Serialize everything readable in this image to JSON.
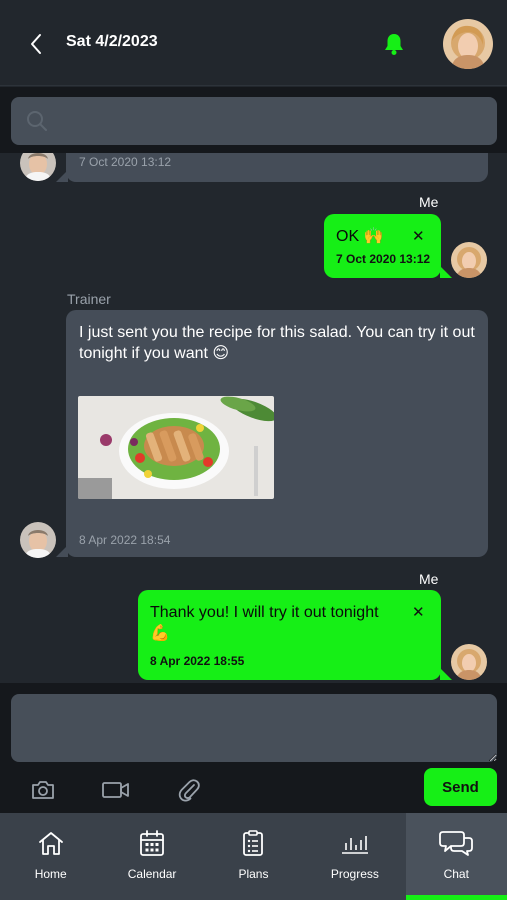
{
  "header": {
    "title": "Sat 4/2/2023"
  },
  "search": {
    "placeholder": ""
  },
  "messages": [
    {
      "direction": "in",
      "timestamp": "7 Oct 2020 13:12"
    },
    {
      "direction": "out",
      "sender": "Me",
      "text": "OK 🙌",
      "timestamp": "7 Oct 2020 13:12"
    },
    {
      "direction": "in",
      "sender": "Trainer",
      "text": "I just sent you the recipe for this salad. You can try it out tonight if you want 😊",
      "timestamp": "8 Apr 2022 18:54"
    },
    {
      "direction": "out",
      "sender": "Me",
      "text": "Thank you! I will try it out tonight 💪",
      "timestamp": "8 Apr 2022 18:55"
    }
  ],
  "composer": {
    "placeholder": "",
    "send_label": "Send"
  },
  "nav": {
    "items": [
      {
        "label": "Home",
        "icon": "home-icon"
      },
      {
        "label": "Calendar",
        "icon": "calendar-icon"
      },
      {
        "label": "Plans",
        "icon": "clipboard-icon"
      },
      {
        "label": "Progress",
        "icon": "bar-chart-icon"
      },
      {
        "label": "Chat",
        "icon": "chat-icon",
        "active": true
      }
    ]
  },
  "colors": {
    "accent": "#16ef16",
    "background": "#22272d",
    "bubble_in": "#454d58",
    "input": "#474f59",
    "nav": "#3a414a"
  }
}
